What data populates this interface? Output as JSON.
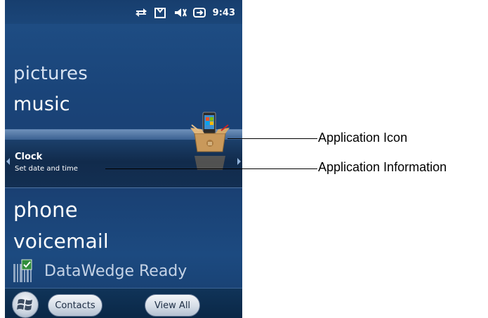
{
  "status_bar": {
    "time": "9:43",
    "icons": [
      "data-sync-icon",
      "notification-icon",
      "volume-muted-icon",
      "battery-charging-icon"
    ]
  },
  "home": {
    "pictures": "pictures",
    "music": "music",
    "phone": "phone",
    "voicemail": "voicemail",
    "selected_app": {
      "title": "Clock",
      "subtitle": "Set date and time"
    },
    "datawedge": "DataWedge Ready"
  },
  "softkeys": {
    "contacts": "Contacts",
    "view_all": "View All"
  },
  "callouts": {
    "application_icon": "Application Icon",
    "application_information": "Application Information"
  },
  "colors": {
    "screen_blue": "#1a4479",
    "band_dark": "#112b4c",
    "text_white": "#ffffff"
  }
}
